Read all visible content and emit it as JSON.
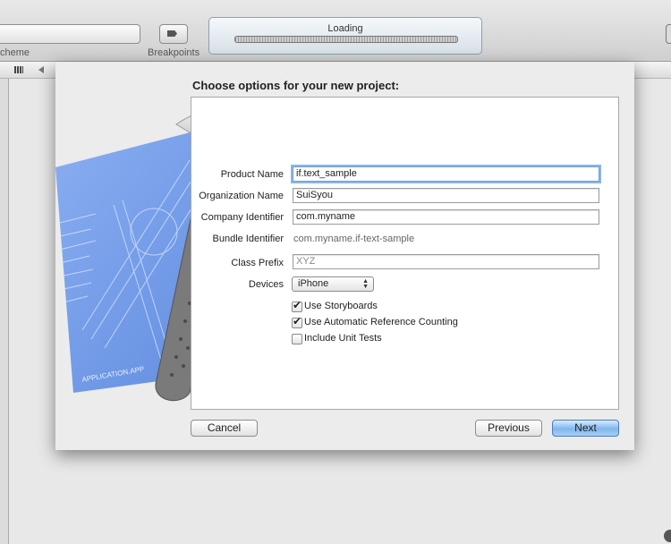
{
  "toolbar": {
    "scheme_label": "cheme",
    "breakpoints_label": "Breakpoints",
    "activity_title": "Loading"
  },
  "sheet": {
    "title": "Choose options for your new project:",
    "fields": {
      "product_name": {
        "label": "Product Name",
        "value": "if.text_sample"
      },
      "organization_name": {
        "label": "Organization Name",
        "value": "SuiSyou"
      },
      "company_identifier": {
        "label": "Company Identifier",
        "value": "com.myname"
      },
      "bundle_identifier": {
        "label": "Bundle Identifier",
        "value": "com.myname.if-text-sample"
      },
      "class_prefix": {
        "label": "Class Prefix",
        "placeholder": "XYZ"
      },
      "devices": {
        "label": "Devices",
        "value": "iPhone"
      }
    },
    "options": {
      "use_storyboards": {
        "label": "Use Storyboards",
        "checked": true
      },
      "use_arc": {
        "label": "Use Automatic Reference Counting",
        "checked": true
      },
      "include_unit_tests": {
        "label": "Include Unit Tests",
        "checked": false
      }
    },
    "buttons": {
      "cancel": "Cancel",
      "previous": "Previous",
      "next": "Next"
    },
    "art_text": "APPLICATION.APP"
  },
  "colors": {
    "blueprint": "#5f8fe6",
    "focus_ring": "#8ab6ea",
    "next_button": "#7fb7ec"
  },
  "icons": [
    "grid-icon",
    "back-icon",
    "breakpoint-icon",
    "checkmark-icon"
  ]
}
